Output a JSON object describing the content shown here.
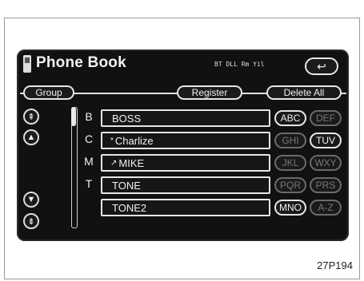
{
  "title": "Phone Book",
  "signal_text": "BT  DLL  Rm  Yil",
  "buttons": {
    "back": "↩",
    "group": "Group",
    "register": "Register",
    "delete_all": "Delete All"
  },
  "scroll": {
    "page_up": "⇞",
    "up": "▲",
    "down": "▼",
    "page_down": "⇟"
  },
  "entries": [
    {
      "letter": "B",
      "name": "BOSS",
      "mark": ""
    },
    {
      "letter": "C",
      "name": "Charlize",
      "mark": "*"
    },
    {
      "letter": "M",
      "name": "MIKE",
      "mark": "↗"
    },
    {
      "letter": "T",
      "name": "TONE",
      "mark": ""
    },
    {
      "letter": "",
      "name": "TONE2",
      "mark": ""
    }
  ],
  "keys": [
    {
      "label": "ABC",
      "enabled": true
    },
    {
      "label": "DEF",
      "enabled": false
    },
    {
      "label": "GHI",
      "enabled": false
    },
    {
      "label": "TUV",
      "enabled": true
    },
    {
      "label": "JKL",
      "enabled": false
    },
    {
      "label": "WXY",
      "enabled": false
    },
    {
      "label": "PQR",
      "enabled": false
    },
    {
      "label": "PRS",
      "enabled": false
    },
    {
      "label": "MNO",
      "enabled": true
    },
    {
      "label": "A-Z",
      "enabled": false
    }
  ],
  "figure_code": "27P194"
}
